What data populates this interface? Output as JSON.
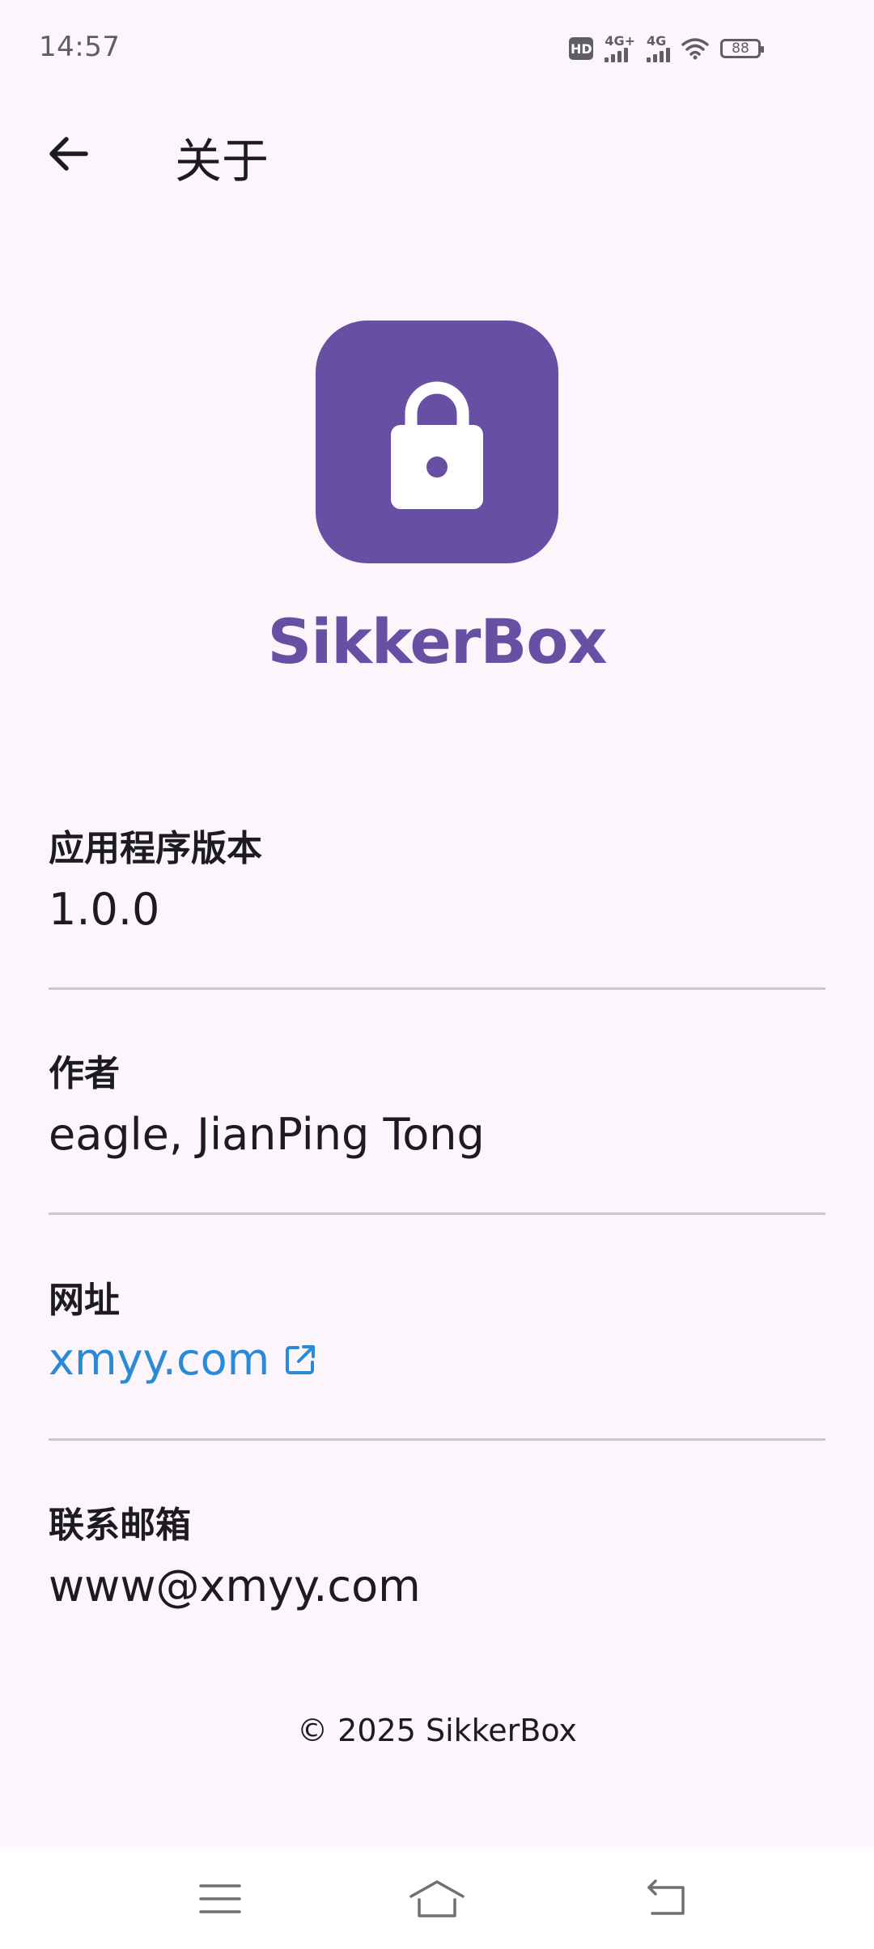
{
  "status_bar": {
    "time": "14:57",
    "hd_label": "HD",
    "sim1_label": "4G+",
    "sim2_label": "4G",
    "battery": "88"
  },
  "header": {
    "title": "关于",
    "back_icon": "arrow-left-icon"
  },
  "app": {
    "name": "SikkerBox",
    "icon": "lock-icon",
    "icon_color": "#6750a4"
  },
  "info": {
    "version_label": "应用程序版本",
    "version_value": "1.0.0",
    "author_label": "作者",
    "author_value": "eagle, JianPing Tong",
    "website_label": "网址",
    "website_value": "xmyy.com",
    "email_label": "联系邮箱",
    "email_value": "www@xmyy.com"
  },
  "footer": {
    "copyright": "© 2025 SikkerBox"
  },
  "nav": {
    "menu_icon": "menu-icon",
    "home_icon": "home-icon",
    "back_icon": "back-icon"
  },
  "colors": {
    "accent": "#6750a4",
    "link": "#2b8ad8",
    "background": "#fcf6fc"
  }
}
